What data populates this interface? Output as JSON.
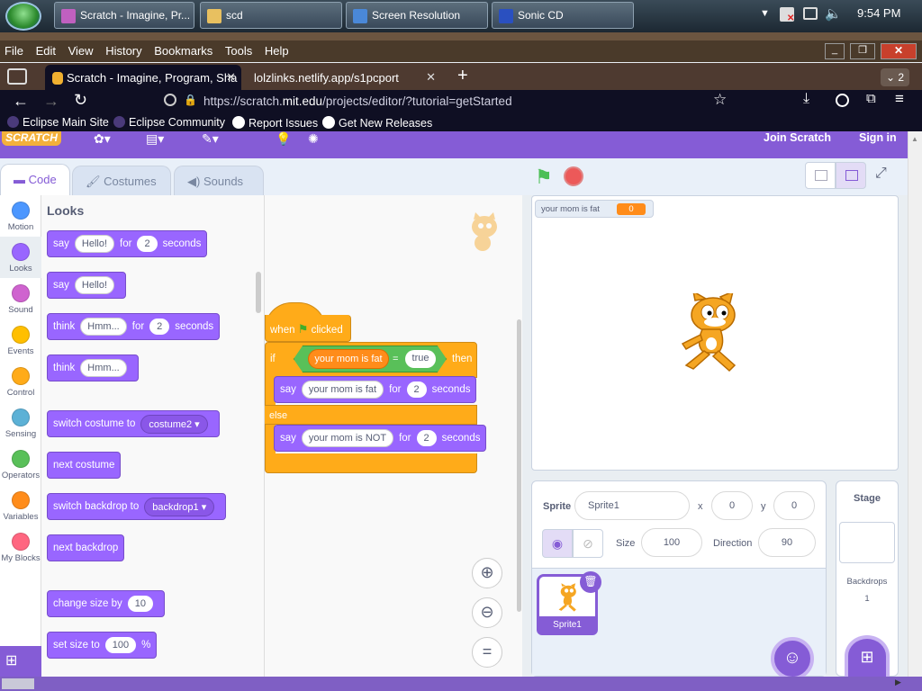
{
  "taskbar": {
    "buttons": [
      {
        "label": "Scratch - Imagine, Pr..."
      },
      {
        "label": "scd"
      },
      {
        "label": "Screen Resolution"
      },
      {
        "label": "Sonic CD"
      }
    ],
    "clock": "9:54 PM"
  },
  "browser": {
    "menu": [
      "File",
      "Edit",
      "View",
      "History",
      "Bookmarks",
      "Tools",
      "Help"
    ],
    "tabs": [
      {
        "label": "Scratch - Imagine, Program, Sha"
      },
      {
        "label": "lolzlinks.netlify.app/s1pcport"
      }
    ],
    "tab_count": "2",
    "url_prefix": "https://scratch.",
    "url_domain": "mit.edu",
    "url_rest": "/projects/editor/?tutorial=getStarted",
    "bookmarks": [
      "Eclipse Main Site",
      "Eclipse Community",
      "Report Issues",
      "Get New Releases"
    ]
  },
  "scratch": {
    "logo": "SCRATCH",
    "join": "Join Scratch",
    "signin": "Sign in",
    "tabs": {
      "code": "Code",
      "costumes": "Costumes",
      "sounds": "Sounds"
    },
    "categories": [
      {
        "label": "Motion",
        "color": "#4c97ff"
      },
      {
        "label": "Looks",
        "color": "#9966ff"
      },
      {
        "label": "Sound",
        "color": "#cf63cf"
      },
      {
        "label": "Events",
        "color": "#ffbf00"
      },
      {
        "label": "Control",
        "color": "#ffab19"
      },
      {
        "label": "Sensing",
        "color": "#5cb1d6"
      },
      {
        "label": "Operators",
        "color": "#59c059"
      },
      {
        "label": "Variables",
        "color": "#ff8c1a"
      },
      {
        "label": "My Blocks",
        "color": "#ff6680"
      }
    ],
    "palette": {
      "title": "Looks",
      "say_for": {
        "say": "say",
        "text": "Hello!",
        "for": "for",
        "secs": "2",
        "seconds": "seconds"
      },
      "say": {
        "say": "say",
        "text": "Hello!"
      },
      "think_for": {
        "think": "think",
        "text": "Hmm...",
        "for": "for",
        "secs": "2",
        "seconds": "seconds"
      },
      "think": {
        "think": "think",
        "text": "Hmm..."
      },
      "switch_costume": {
        "label": "switch costume to",
        "value": "costume2"
      },
      "next_costume": "next costume",
      "switch_backdrop": {
        "label": "switch backdrop to",
        "value": "backdrop1"
      },
      "next_backdrop": "next backdrop",
      "change_size": {
        "label": "change size by",
        "value": "10"
      },
      "set_size": {
        "label": "set size to",
        "value": "100",
        "unit": "%"
      }
    },
    "script": {
      "when": "when",
      "clicked": "clicked",
      "if": "if",
      "var": "your mom is fat",
      "eq": "=",
      "true": "true",
      "then": "then",
      "say1": {
        "say": "say",
        "text": "your mom is fat",
        "for": "for",
        "secs": "2",
        "seconds": "seconds"
      },
      "else": "else",
      "say2": {
        "say": "say",
        "text": "your mom is NOT",
        "for": "for",
        "secs": "2",
        "seconds": "seconds"
      },
      "zoom_reset": "="
    },
    "stage": {
      "monitor_label": "your mom is fat",
      "monitor_value": "0"
    },
    "sprite": {
      "sprite_label": "Sprite",
      "name": "Sprite1",
      "x_label": "x",
      "x": "0",
      "y_label": "y",
      "y": "0",
      "size_label": "Size",
      "size": "100",
      "direction_label": "Direction",
      "direction": "90",
      "thumb_name": "Sprite1"
    },
    "stage_panel": {
      "title": "Stage",
      "backdrops_label": "Backdrops",
      "backdrops_count": "1"
    }
  }
}
